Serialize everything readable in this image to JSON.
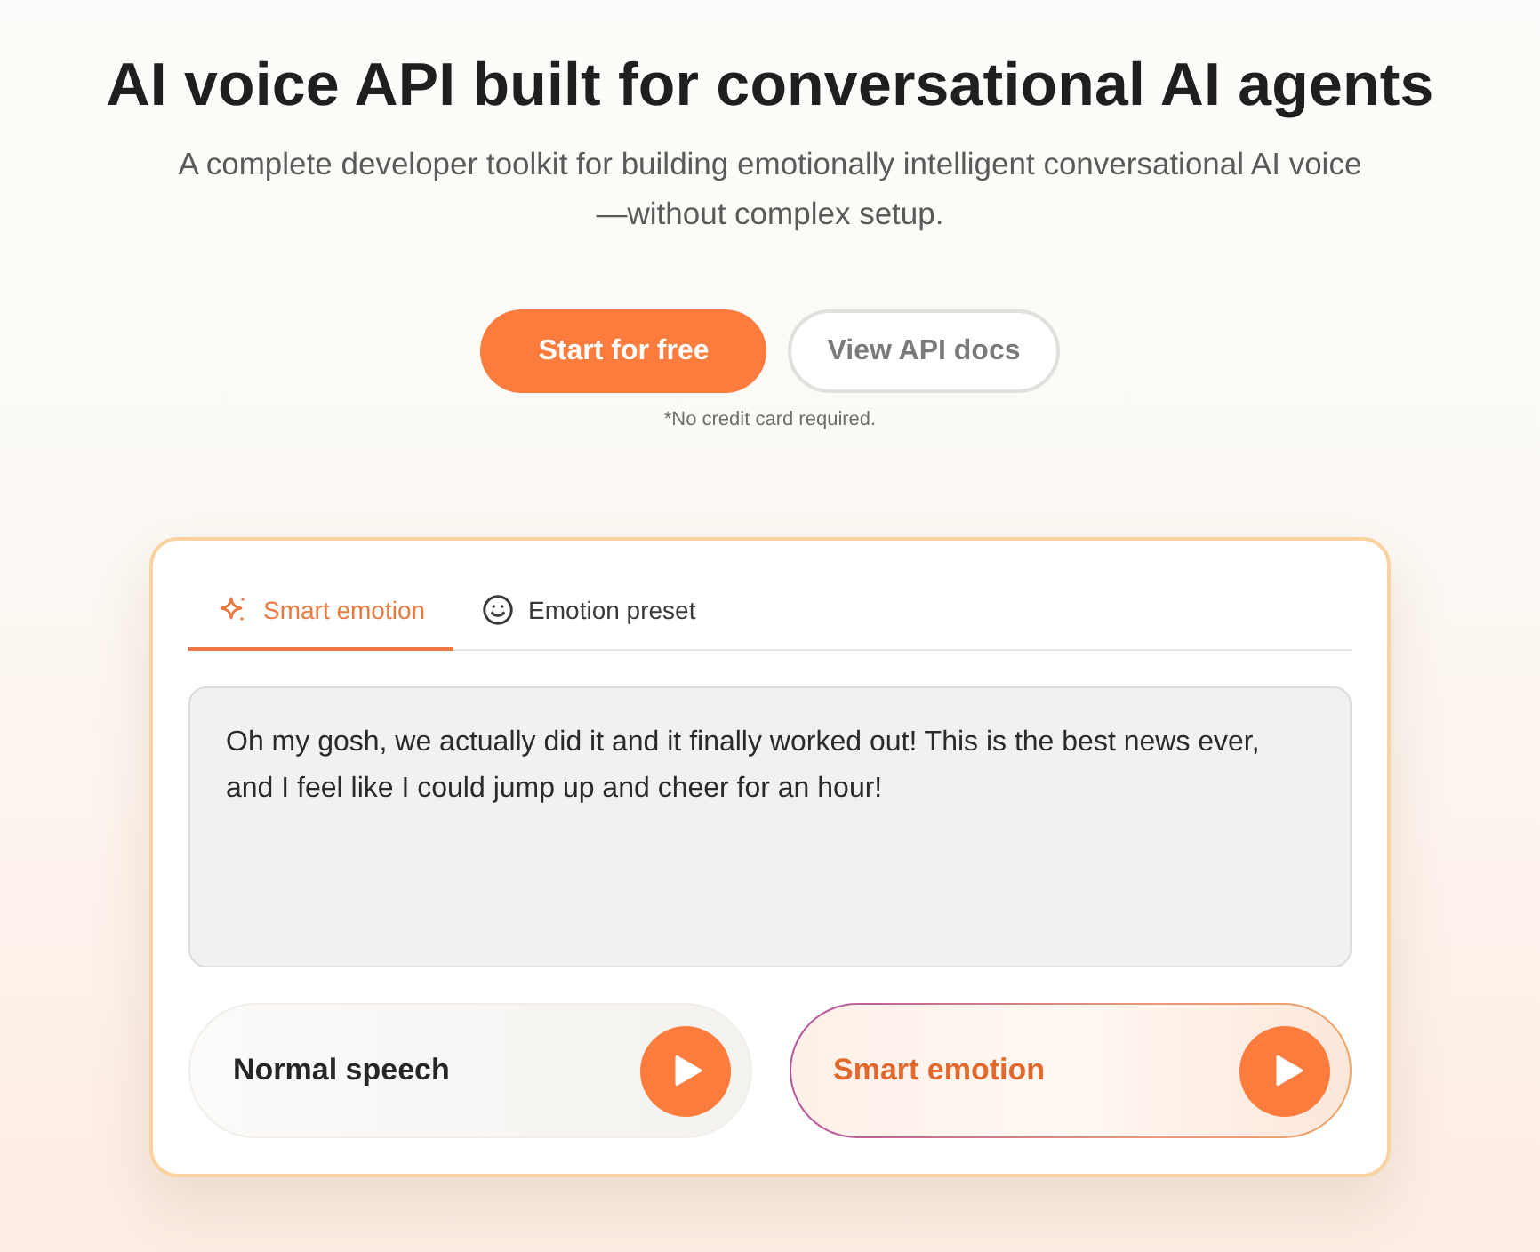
{
  "hero": {
    "title": "AI voice API built for conversational AI agents",
    "subtitle_lines": [
      "A complete developer toolkit for building emotionally intelligent conversational AI voice",
      "—without complex setup."
    ]
  },
  "actions": [
    {
      "label": "Start for free",
      "kind": "primary"
    },
    {
      "label": "View API docs",
      "kind": "secondary"
    }
  ],
  "note": "*No credit card required.",
  "demo": {
    "tabs": [
      {
        "label": "Smart emotion",
        "selected": true
      },
      {
        "label": "Emotion preset",
        "selected": false
      }
    ],
    "text_input": {
      "value": "Oh my gosh, we actually did it and it finally worked out! This is the best news ever, and I feel like I could jump up and cheer for an hour!"
    },
    "samples": [
      {
        "label": "Normal speech",
        "selected": false
      },
      {
        "label": "Smart emotion",
        "selected": true
      }
    ]
  }
}
